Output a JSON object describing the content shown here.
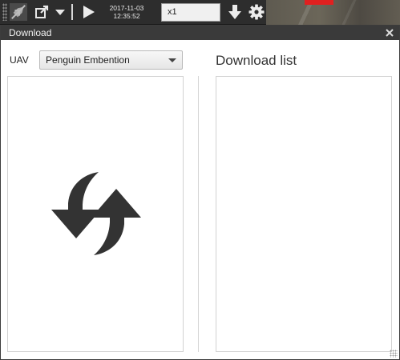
{
  "toolbar": {
    "date": "2017-11-03",
    "time": "12:35:52",
    "speed": "x1",
    "icons": [
      "plane-icon",
      "open-external-icon",
      "chevron-down-icon",
      "play-icon",
      "download-icon",
      "gear-icon"
    ]
  },
  "dialog": {
    "title": "Download",
    "uav_label": "UAV",
    "uav_selected": "Penguin Embention",
    "download_list_title": "Download list"
  },
  "colors": {
    "toolbar_bg": "#2d2d2d",
    "titlebar_bg": "#3a3a3a",
    "icon_dark": "#333333",
    "map_marker": "#e02020"
  }
}
